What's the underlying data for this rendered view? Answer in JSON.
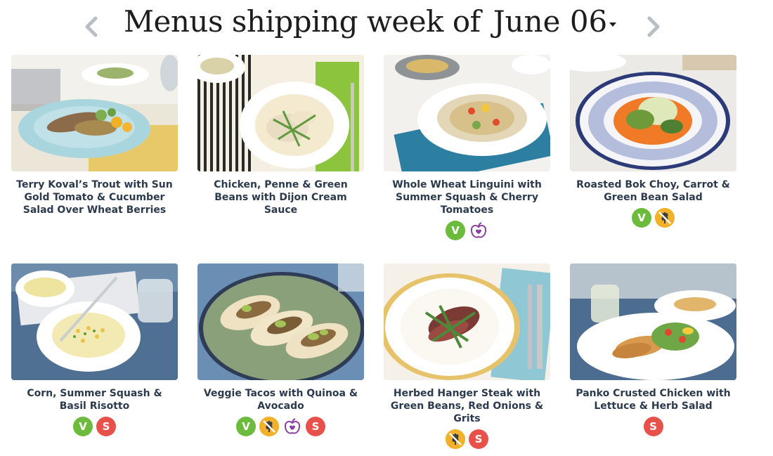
{
  "header": {
    "title": "Menus shipping week of",
    "date": "June 06"
  },
  "recipes": [
    {
      "name": "Terry Koval’s Trout with Sun Gold Tomato & Cucumber Salad Over Wheat Berries",
      "badges": []
    },
    {
      "name": "Chicken, Penne & Green Beans with Dijon Cream Sauce",
      "badges": []
    },
    {
      "name": "Whole Wheat Linguini with Summer Squash & Cherry Tomatoes",
      "badges": [
        "vegetarian-icon",
        "apple-icon"
      ]
    },
    {
      "name": "Roasted Bok Choy, Carrot & Green Bean Salad",
      "badges": [
        "vegetarian-icon",
        "gluten-free-icon"
      ]
    },
    {
      "name": "Corn, Summer Squash & Basil Risotto",
      "badges": [
        "vegetarian-icon",
        "spicy-icon"
      ]
    },
    {
      "name": "Veggie Tacos with Quinoa & Avocado",
      "badges": [
        "vegetarian-icon",
        "gluten-free-icon",
        "apple-icon",
        "spicy-icon"
      ]
    },
    {
      "name": "Herbed Hanger Steak with Green Beans, Red Onions & Grits",
      "badges": [
        "gluten-free-icon",
        "spicy-icon"
      ]
    },
    {
      "name": "Panko Crusted Chicken with Lettuce & Herb Salad",
      "badges": [
        "spicy-icon"
      ]
    }
  ],
  "badge_letters": {
    "vegetarian": "V",
    "spicy": "S"
  },
  "colors": {
    "vegetarian": "#6dbb3c",
    "spicy": "#e8504a",
    "gluten_free": "#f2b12a",
    "apple": "#8b3fa0",
    "arrow": "#b9bec4",
    "text": "#2c3a4e"
  }
}
